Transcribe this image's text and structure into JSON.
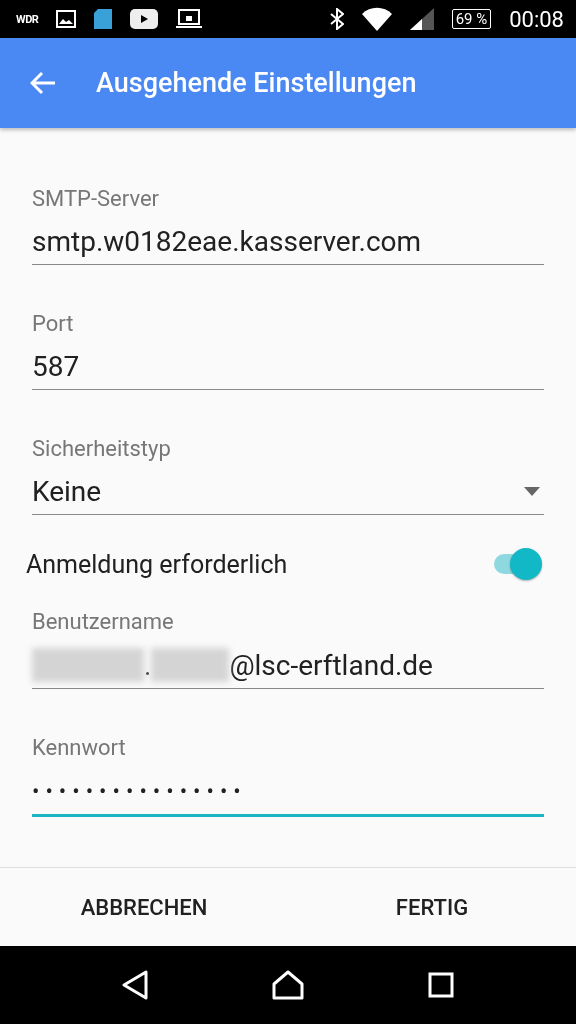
{
  "status_bar": {
    "app_label": "WDR",
    "battery": "69 %",
    "time": "00:08"
  },
  "app_bar": {
    "title": "Ausgehende Einstellungen"
  },
  "fields": [
    {
      "kind": "text",
      "label": "SMTP-Server",
      "value": "smtp.w0182eae.kasserver.com",
      "focused": false
    },
    {
      "kind": "text",
      "label": "Port",
      "value": "587",
      "focused": false
    },
    {
      "kind": "dropdown",
      "label": "Sicherheitstyp",
      "value": "Keine",
      "focused": false
    },
    {
      "kind": "toggle",
      "label": "Anmeldung erforderlich",
      "on": true
    },
    {
      "kind": "redacted",
      "label": "Benutzername",
      "segments": [
        {
          "kind": "blur"
        },
        {
          "kind": "text",
          "text": "."
        },
        {
          "kind": "blur"
        },
        {
          "kind": "text",
          "text": "@lsc-erftland.de"
        }
      ],
      "focused": false
    },
    {
      "kind": "password",
      "label": "Kennwort",
      "value": "••••••••••••••••",
      "focused": true
    }
  ],
  "buttons": [
    "ABBRECHEN",
    "FERTIG"
  ]
}
